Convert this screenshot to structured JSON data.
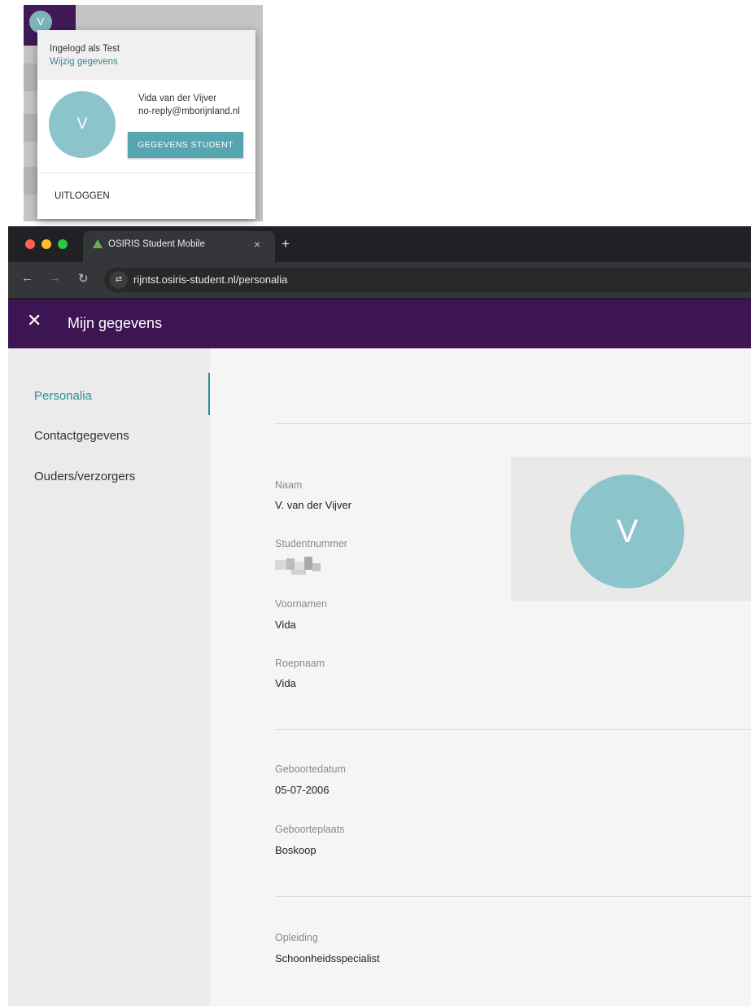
{
  "popup": {
    "avatar_initial": "V",
    "logged_in_text": "Ingelogd als Test",
    "edit_link": "Wijzig gegevens",
    "student_name": "Vida van der Vijver",
    "student_email": "no-reply@mborijnland.nl",
    "student_button": "GEGEVENS STUDENT",
    "logout": "UITLOGGEN"
  },
  "browser": {
    "tab_title": "OSIRIS Student Mobile",
    "tab_close": "×",
    "new_tab": "+",
    "url": "rijntst.osiris-student.nl/personalia"
  },
  "appbar": {
    "close_glyph": "✕",
    "title": "Mijn gegevens"
  },
  "sidebar": {
    "items": [
      {
        "label": "Personalia"
      },
      {
        "label": "Contactgegevens"
      },
      {
        "label": "Ouders/verzorgers"
      }
    ]
  },
  "personalia": {
    "naam_label": "Naam",
    "naam_value": "V. van der Vijver",
    "studentnummer_label": "Studentnummer",
    "voornamen_label": "Voornamen",
    "voornamen_value": "Vida",
    "roepnaam_label": "Roepnaam",
    "roepnaam_value": "Vida",
    "geboortedatum_label": "Geboortedatum",
    "geboortedatum_value": "05-07-2006",
    "geboorteplaats_label": "Geboorteplaats",
    "geboorteplaats_value": "Boskoop",
    "opleiding_label": "Opleiding",
    "opleiding_value": "Schoonheidsspecialist",
    "photo_initial": "V"
  },
  "colors": {
    "appbar": "#3d1552",
    "accent": "#2f8c99",
    "button": "#55a6b0",
    "avatar": "#8cc4cb"
  }
}
